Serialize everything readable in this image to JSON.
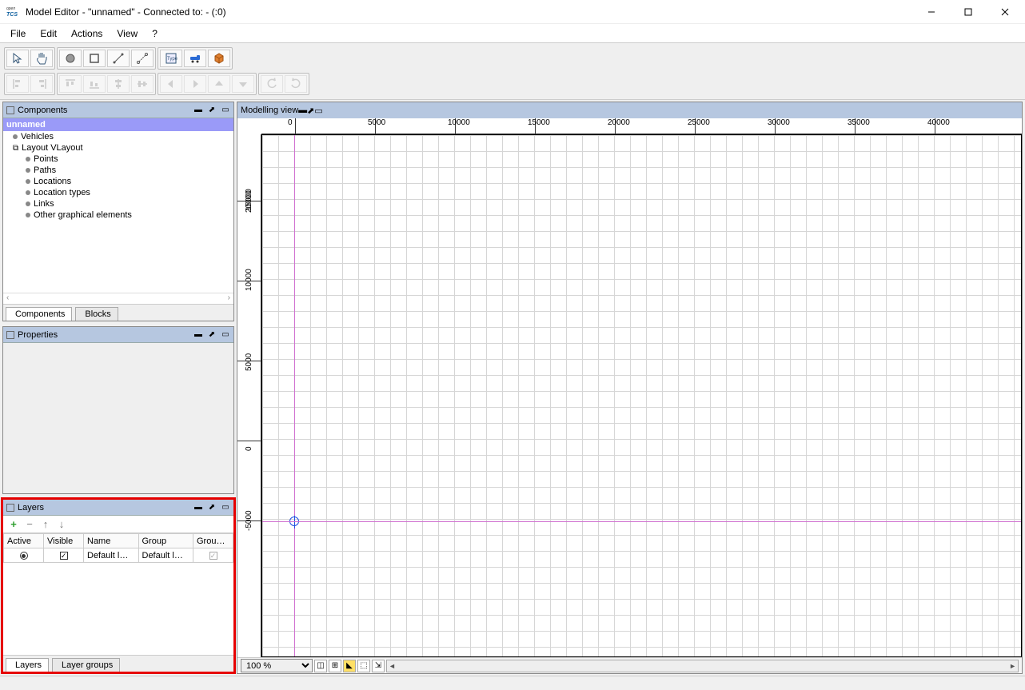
{
  "window": {
    "title": "Model Editor - \"unnamed\" - Connected to: - (:0)",
    "logo_top": "open",
    "logo_main": "TCS"
  },
  "menu": [
    "File",
    "Edit",
    "Actions",
    "View",
    "?"
  ],
  "panels": {
    "components": {
      "title": "Components",
      "root": "unnamed",
      "items": [
        {
          "label": "Vehicles",
          "icon": "dot",
          "indent": 0
        },
        {
          "label": "Layout VLayout",
          "icon": "layout",
          "indent": 0
        },
        {
          "label": "Points",
          "icon": "dot",
          "indent": 1
        },
        {
          "label": "Paths",
          "icon": "dot",
          "indent": 1
        },
        {
          "label": "Locations",
          "icon": "dot",
          "indent": 1
        },
        {
          "label": "Location types",
          "icon": "dot",
          "indent": 1
        },
        {
          "label": "Links",
          "icon": "dot",
          "indent": 1
        },
        {
          "label": "Other graphical elements",
          "icon": "dot",
          "indent": 1
        }
      ],
      "tabs": [
        "Components",
        "Blocks"
      ]
    },
    "properties": {
      "title": "Properties"
    },
    "layers": {
      "title": "Layers",
      "headers": [
        "Active",
        "Visible",
        "Name",
        "Group",
        "Group ..."
      ],
      "row": {
        "active": true,
        "visible": true,
        "name": "Default l…",
        "group": "Default l…",
        "group_vis": true
      },
      "tabs": [
        "Layers",
        "Layer groups"
      ]
    },
    "modelling": {
      "title": "Modelling view"
    }
  },
  "ruler_h": [
    "0",
    "5000",
    "10000",
    "15000",
    "20000",
    "25000",
    "30000",
    "35000",
    "40000"
  ],
  "ruler_v": [
    "20000",
    "15000",
    "10000",
    "5000",
    "0",
    "-5000"
  ],
  "zoom": "100 %",
  "colors": {
    "accent": "#b6c7e0",
    "selected": "#9a9af8",
    "outline": "#e60000"
  }
}
